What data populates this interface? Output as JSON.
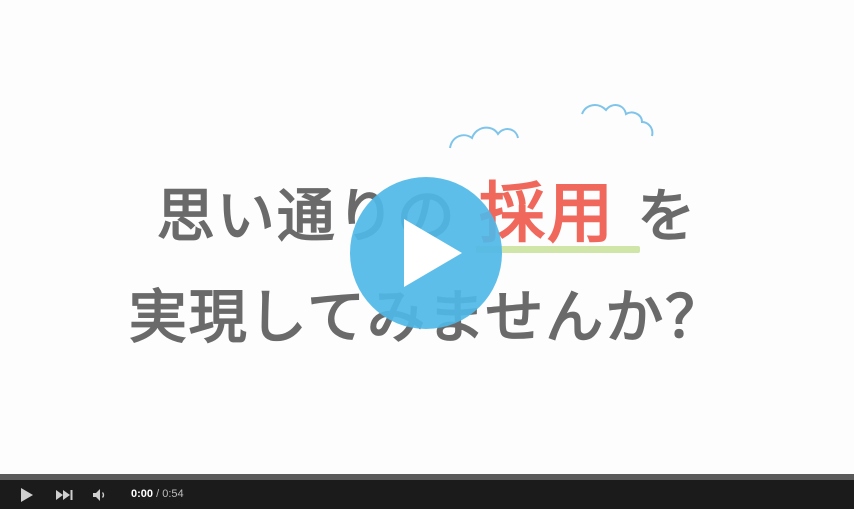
{
  "video": {
    "headline_line1_before": "思い通りの",
    "headline_line1_accent": "採用",
    "headline_line1_after": "を",
    "headline_line2": "実現してみませんか？"
  },
  "player": {
    "current_time": "0:00",
    "separator": "/",
    "duration": "0:54",
    "progress": 0,
    "icons": {
      "play": "play-icon",
      "skip_next": "skip-next-icon",
      "volume": "volume-icon",
      "overlay_play": "play-overlay-icon"
    },
    "colors": {
      "overlay": "#50b8e8",
      "accent_text": "#f0685c",
      "bar": "#1b1b1b"
    }
  }
}
